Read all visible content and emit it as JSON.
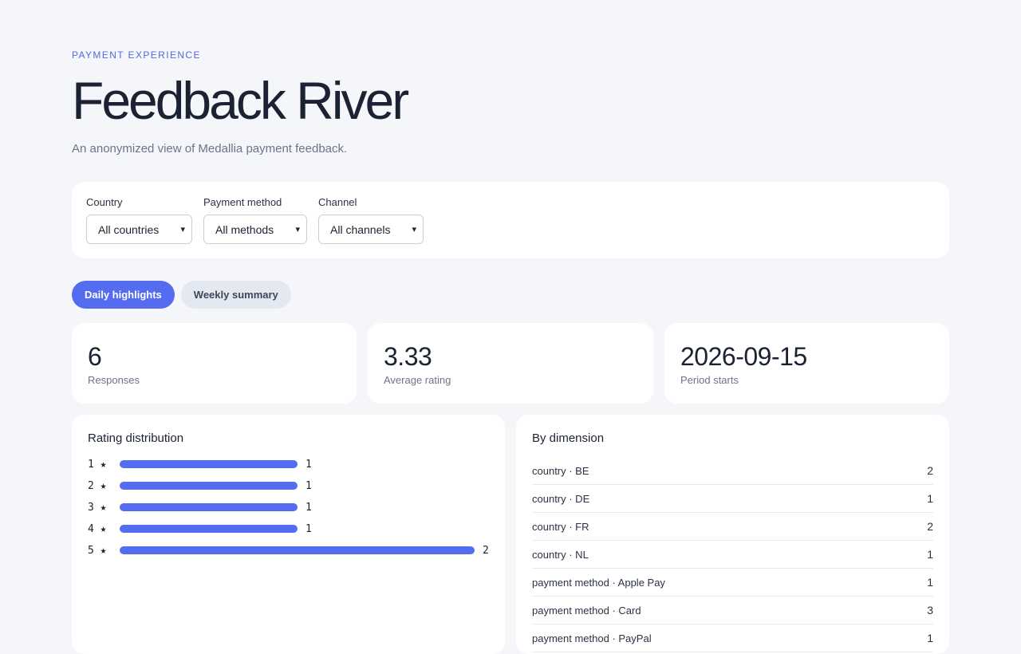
{
  "header": {
    "eyebrow": "PAYMENT EXPERIENCE",
    "title": "Feedback River",
    "subtitle": "An anonymized view of Medallia payment feedback."
  },
  "filters": [
    {
      "label": "Country",
      "value": "All countries"
    },
    {
      "label": "Payment method",
      "value": "All methods"
    },
    {
      "label": "Channel",
      "value": "All channels"
    }
  ],
  "tabs": [
    {
      "label": "Daily highlights",
      "active": true
    },
    {
      "label": "Weekly summary",
      "active": false
    }
  ],
  "stats": [
    {
      "value": "6",
      "label": "Responses"
    },
    {
      "value": "3.33",
      "label": "Average rating"
    },
    {
      "value": "2026-09-15",
      "label": "Period starts"
    }
  ],
  "rating_distribution": {
    "title": "Rating distribution",
    "rows": [
      {
        "label": "1 ★",
        "count": 1
      },
      {
        "label": "2 ★",
        "count": 1
      },
      {
        "label": "3 ★",
        "count": 1
      },
      {
        "label": "4 ★",
        "count": 1
      },
      {
        "label": "5 ★",
        "count": 2
      }
    ],
    "max": 2,
    "bar_color": "#546cf0"
  },
  "by_dimension": {
    "title": "By dimension",
    "rows": [
      {
        "label": "country · BE",
        "value": "2"
      },
      {
        "label": "country · DE",
        "value": "1"
      },
      {
        "label": "country · FR",
        "value": "2"
      },
      {
        "label": "country · NL",
        "value": "1"
      },
      {
        "label": "payment method · Apple Pay",
        "value": "1"
      },
      {
        "label": "payment method · Card",
        "value": "3"
      },
      {
        "label": "payment method · PayPal",
        "value": "1"
      }
    ]
  },
  "colors": {
    "accent": "#546cf0",
    "background": "#f4f6fa"
  }
}
